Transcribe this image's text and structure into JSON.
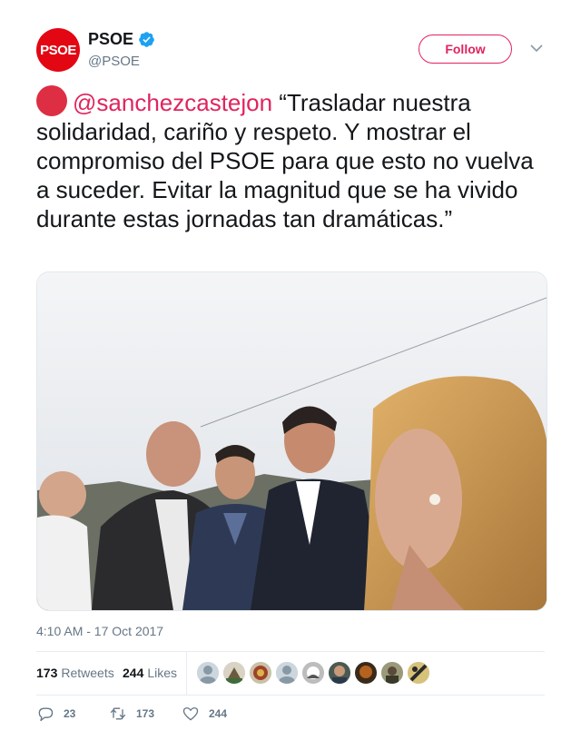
{
  "account": {
    "display_name": "PSOE",
    "handle": "@PSOE",
    "avatar_text": "PSOE",
    "verified": true,
    "brand_color": "#e30613"
  },
  "follow_button": {
    "label": "Follow",
    "color": "#e0245e"
  },
  "tweet": {
    "emoji": "red-circle",
    "mention": "@sanchezcastejon",
    "body": " “Trasladar nuestra solidaridad, cariño y respeto. Y mostrar el compromiso del PSOE para que esto no vuelva a suceder. Evitar la magnitud que se ha vivido durante estas jornadas tan dramáticas.”",
    "timestamp": "4:10 AM - 17 Oct 2017"
  },
  "stats": {
    "retweets_count": "173",
    "retweets_label": "Retweets",
    "likes_count": "244",
    "likes_label": "Likes",
    "liker_avatar_count": 9
  },
  "actions": {
    "reply_count": "23",
    "retweet_count": "173",
    "like_count": "244"
  },
  "colors": {
    "text": "#14171a",
    "secondary": "#657786",
    "verified": "#1da1f2",
    "mention": "#e0245e"
  }
}
